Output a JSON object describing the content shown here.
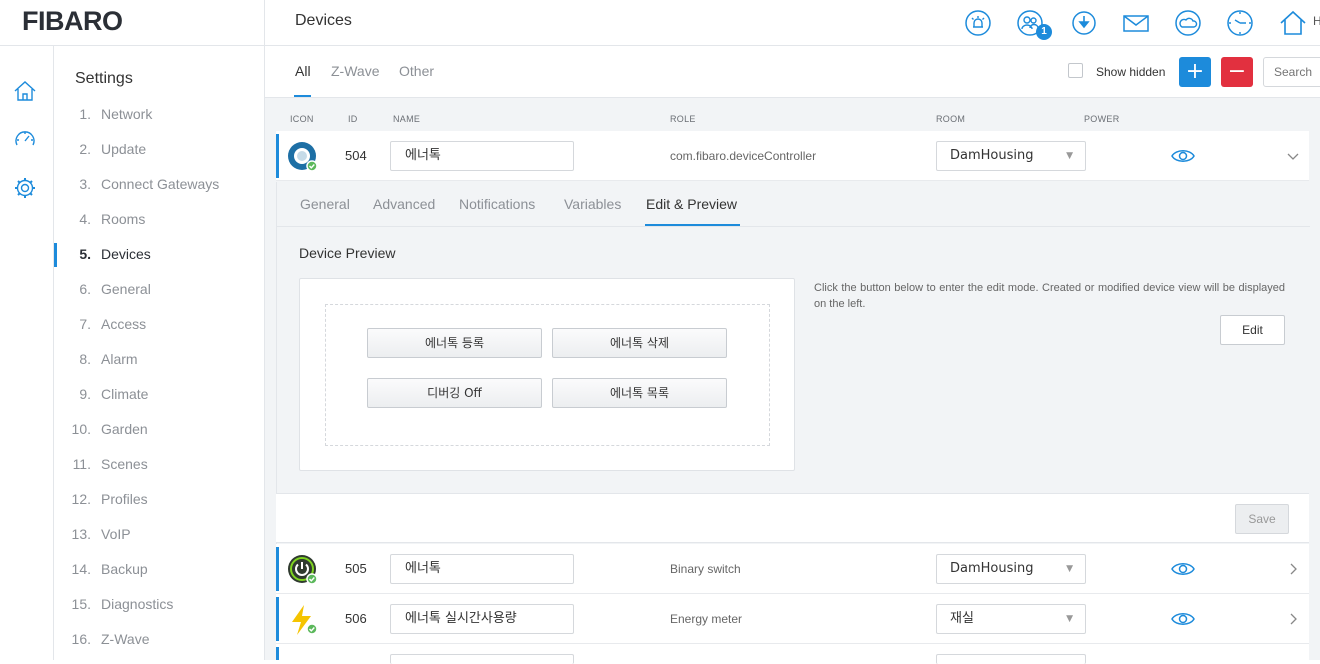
{
  "app": {
    "logo": "FIBARO",
    "page_title": "Devices",
    "home_label": "H"
  },
  "topbar": {
    "icons": [
      "alarm-icon",
      "users-icon",
      "download-icon",
      "mail-icon",
      "weather-icon",
      "clock-icon",
      "home-icon"
    ],
    "users_badge": "1"
  },
  "rail": {
    "icons": [
      "home-icon",
      "dashboard-icon",
      "gear-icon"
    ]
  },
  "settings_menu": {
    "title": "Settings",
    "items": [
      {
        "num": "1.",
        "label": "Network"
      },
      {
        "num": "2.",
        "label": "Update"
      },
      {
        "num": "3.",
        "label": "Connect Gateways"
      },
      {
        "num": "4.",
        "label": "Rooms"
      },
      {
        "num": "5.",
        "label": "Devices"
      },
      {
        "num": "6.",
        "label": "General"
      },
      {
        "num": "7.",
        "label": "Access"
      },
      {
        "num": "8.",
        "label": "Alarm"
      },
      {
        "num": "9.",
        "label": "Climate"
      },
      {
        "num": "10.",
        "label": "Garden"
      },
      {
        "num": "11.",
        "label": "Scenes"
      },
      {
        "num": "12.",
        "label": "Profiles"
      },
      {
        "num": "13.",
        "label": "VoIP"
      },
      {
        "num": "14.",
        "label": "Backup"
      },
      {
        "num": "15.",
        "label": "Diagnostics"
      },
      {
        "num": "16.",
        "label": "Z-Wave"
      }
    ],
    "active_index": 4
  },
  "filter_tabs": [
    {
      "label": "All"
    },
    {
      "label": "Z-Wave"
    },
    {
      "label": "Other"
    }
  ],
  "toolbar": {
    "show_hidden_label": "Show hidden",
    "add_symbol": "+",
    "remove_symbol": "−",
    "search_placeholder": "Search"
  },
  "table": {
    "headers": {
      "icon": "ICON",
      "id": "ID",
      "name": "NAME",
      "role": "ROLE",
      "room": "ROOM",
      "power": "POWER"
    },
    "rows": [
      {
        "id": "504",
        "name": "에너톡",
        "role": "com.fibaro.deviceController",
        "room": "DamHousing",
        "icon": "device-controller-icon"
      },
      {
        "id": "505",
        "name": "에너톡",
        "role": "Binary switch",
        "room": "DamHousing",
        "icon": "power-switch-icon"
      },
      {
        "id": "506",
        "name": "에너톡 실시간사용량",
        "role": "Energy meter",
        "room": "재실",
        "icon": "energy-bolt-icon"
      }
    ]
  },
  "panel": {
    "tabs": [
      {
        "label": "General"
      },
      {
        "label": "Advanced"
      },
      {
        "label": "Notifications"
      },
      {
        "label": "Variables"
      },
      {
        "label": "Edit & Preview"
      }
    ],
    "active_tab": 4,
    "preview_title": "Device Preview",
    "preview_buttons": [
      "에너톡 등록",
      "에너톡 삭제",
      "디버깅 Off",
      "에너톡 목록"
    ],
    "info_text": "Click the button below to enter the edit mode. Created or modified device view will be displayed on the left.",
    "edit_label": "Edit",
    "save_label": "Save"
  },
  "colors": {
    "accent": "#1d8bdb",
    "danger": "#e2303f",
    "online": "#5cb85c",
    "bolt": "#f5c400"
  }
}
